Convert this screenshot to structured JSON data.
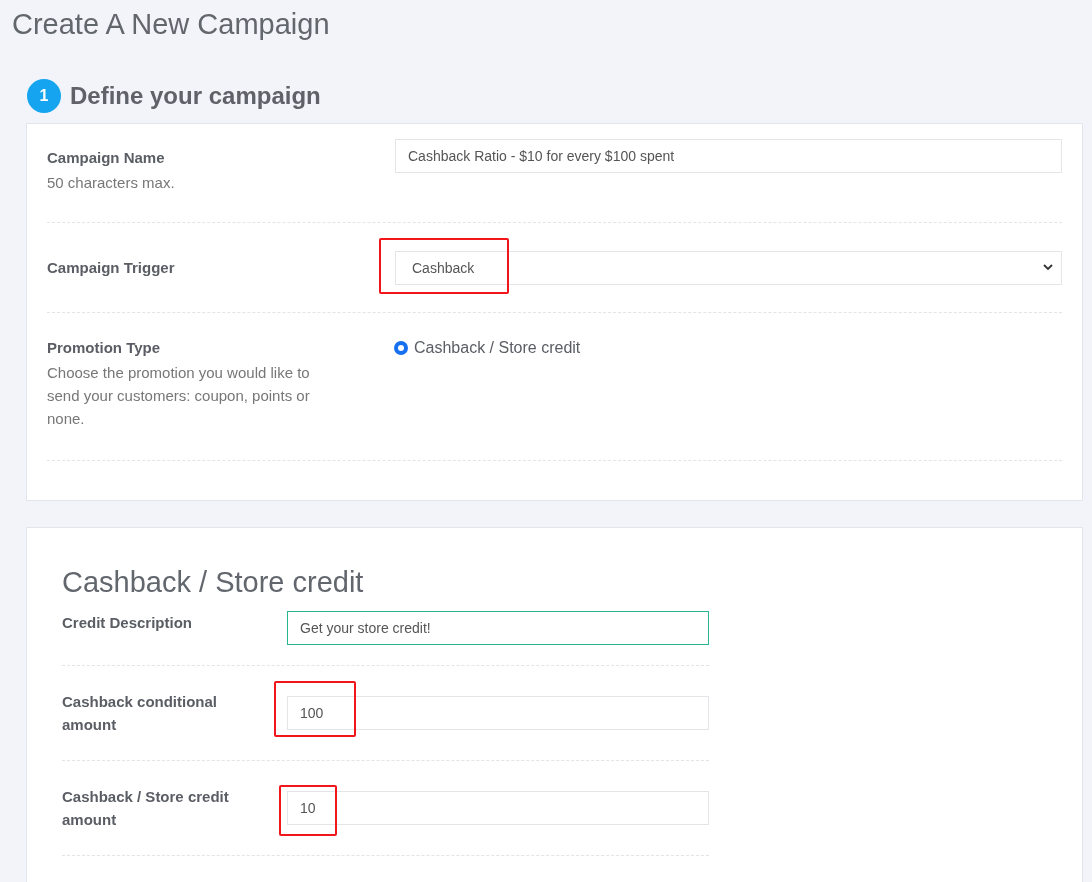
{
  "page_title": "Create A New Campaign",
  "step": {
    "number": "1",
    "title": "Define your campaign"
  },
  "define_rows": [
    {
      "kind": "text",
      "label": "Campaign Name",
      "hint": "50 characters max.",
      "value": "Cashback Ratio - $10 for every $100 spent",
      "highlighted": false
    },
    {
      "kind": "select",
      "label": "Campaign Trigger",
      "value": "Cashback",
      "highlighted": true
    },
    {
      "kind": "radio",
      "label": "Promotion Type",
      "hint": "Choose the promotion you would like to send your customers: coupon, points or none.",
      "options": [
        {
          "label": "Cashback / Store credit",
          "selected": true
        }
      ]
    }
  ],
  "cashback": {
    "title": "Cashback / Store credit",
    "rows": [
      {
        "label": "Credit Description",
        "value": "Get your store credit!",
        "focused": true,
        "highlighted": false
      },
      {
        "label": "Cashback conditional amount",
        "value": "100",
        "focused": false,
        "highlighted": true
      },
      {
        "label": "Cashback / Store credit amount",
        "value": "10",
        "focused": false,
        "highlighted": true
      }
    ]
  }
}
